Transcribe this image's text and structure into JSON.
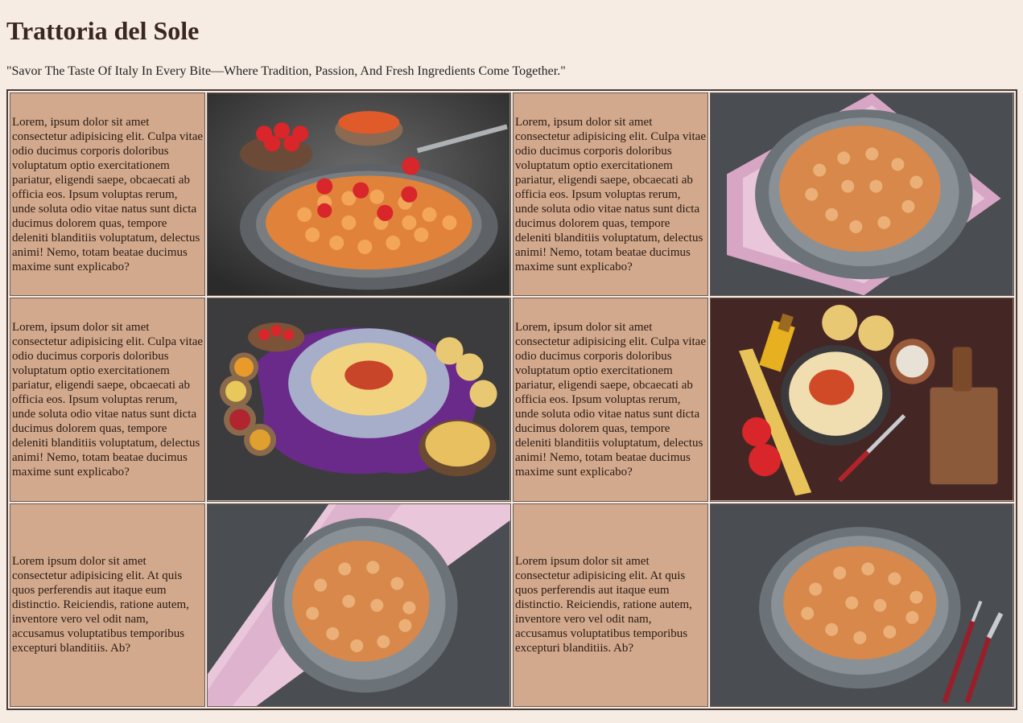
{
  "header": {
    "title": "Trattoria del Sole",
    "tagline": "\"Savor The Taste Of Italy In Every Bite—Where Tradition, Passion, And Fresh Ingredients Come Together.\""
  },
  "menu": {
    "rows": [
      {
        "left_text": "Lorem, ipsum dolor sit amet consectetur adipisicing elit. Culpa vitae odio ducimus corporis doloribus voluptatum optio exercitationem pariatur, eligendi saepe, obcaecati ab officia eos. Ipsum voluptas rerum, unde soluta odio vitae natus sunt dicta ducimus dolorem quas, tempore deleniti blanditiis voluptatum, delectus animi! Nemo, totam beatae ducimus maxime sunt explicabo?",
        "right_text": "Lorem, ipsum dolor sit amet consectetur adipisicing elit. Culpa vitae odio ducimus corporis doloribus voluptatum optio exercitationem pariatur, eligendi saepe, obcaecati ab officia eos. Ipsum voluptas rerum, unde soluta odio vitae natus sunt dicta ducimus dolorem quas, tempore deleniti blanditiis voluptatum, delectus animi! Nemo, totam beatae ducimus maxime sunt explicabo?"
      },
      {
        "left_text": "Lorem, ipsum dolor sit amet consectetur adipisicing elit. Culpa vitae odio ducimus corporis doloribus voluptatum optio exercitationem pariatur, eligendi saepe, obcaecati ab officia eos. Ipsum voluptas rerum, unde soluta odio vitae natus sunt dicta ducimus dolorem quas, tempore deleniti blanditiis voluptatum, delectus animi! Nemo, totam beatae ducimus maxime sunt explicabo?",
        "right_text": "Lorem, ipsum dolor sit amet consectetur adipisicing elit. Culpa vitae odio ducimus corporis doloribus voluptatum optio exercitationem pariatur, eligendi saepe, obcaecati ab officia eos. Ipsum voluptas rerum, unde soluta odio vitae natus sunt dicta ducimus dolorem quas, tempore deleniti blanditiis voluptatum, delectus animi! Nemo, totam beatae ducimus maxime sunt explicabo?"
      },
      {
        "left_text": "Lorem ipsum dolor sit amet consectetur adipisicing elit. At quis quos perferendis aut itaque eum distinctio. Reiciendis, ratione autem, inventore vero vel odit nam, accusamus voluptatibus temporibus excepturi blanditiis. Ab?",
        "right_text": "Lorem ipsum dolor sit amet consectetur adipisicing elit. At quis quos perferendis aut itaque eum distinctio. Reiciendis, ratione autem, inventore vero vel odit nam, accusamus voluptatibus temporibus excepturi blanditiis. Ab?"
      }
    ]
  },
  "colors": {
    "page_background": "#f6ece3",
    "cell_background": "#d2a98c",
    "title_color": "#3a2622"
  }
}
